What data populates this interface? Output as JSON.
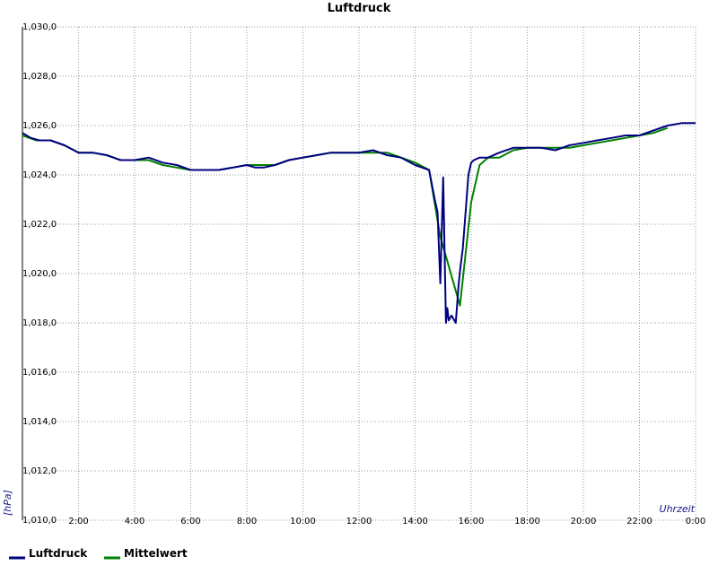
{
  "chart_data": {
    "type": "line",
    "title": "Luftdruck",
    "ylabel": "[hPa]",
    "xlabel": "Uhrzeit",
    "ylim": [
      1010,
      1030
    ],
    "xlim": [
      0,
      24
    ],
    "y_ticks": [
      1010,
      1012,
      1014,
      1016,
      1018,
      1020,
      1022,
      1024,
      1026,
      1028,
      1030
    ],
    "y_tick_labels": [
      "1,010,0",
      "1,012,0",
      "1,014,0",
      "1,016,0",
      "1,018,0",
      "1,020,0",
      "1,022,0",
      "1,024,0",
      "1,026,0",
      "1,028,0",
      "1,030,0"
    ],
    "x_ticks": [
      2,
      4,
      6,
      8,
      10,
      12,
      14,
      16,
      18,
      20,
      22,
      24
    ],
    "x_tick_labels": [
      "2:00",
      "4:00",
      "6:00",
      "8:00",
      "10:00",
      "12:00",
      "14:00",
      "16:00",
      "18:00",
      "20:00",
      "22:00",
      "0:00"
    ],
    "grid": true,
    "legend_position": "bottom-left",
    "series": [
      {
        "name": "Luftdruck",
        "color": "#000080",
        "x": [
          0,
          0.3,
          0.6,
          1.0,
          1.5,
          2.0,
          2.5,
          3.0,
          3.5,
          4.0,
          4.5,
          5.0,
          5.5,
          6.0,
          6.5,
          7.0,
          7.5,
          8.0,
          8.3,
          8.6,
          9.0,
          9.5,
          10.0,
          10.5,
          11.0,
          11.5,
          12.0,
          12.5,
          13.0,
          13.5,
          14.0,
          14.5,
          14.7,
          14.8,
          14.9,
          15.0,
          15.05,
          15.1,
          15.15,
          15.2,
          15.3,
          15.45,
          15.55,
          15.6,
          15.7,
          15.8,
          15.9,
          16.0,
          16.1,
          16.3,
          16.6,
          17.0,
          17.5,
          18.0,
          18.5,
          19.0,
          19.5,
          20.0,
          20.5,
          21.0,
          21.5,
          22.0,
          22.5,
          23.0,
          23.5,
          24.0
        ],
        "y": [
          1025.7,
          1025.5,
          1025.4,
          1025.4,
          1025.2,
          1024.9,
          1024.9,
          1024.8,
          1024.6,
          1024.6,
          1024.7,
          1024.5,
          1024.4,
          1024.2,
          1024.2,
          1024.2,
          1024.3,
          1024.4,
          1024.3,
          1024.3,
          1024.4,
          1024.6,
          1024.7,
          1024.8,
          1024.9,
          1024.9,
          1024.9,
          1025.0,
          1024.8,
          1024.7,
          1024.4,
          1024.2,
          1023.0,
          1022.5,
          1019.6,
          1023.9,
          1021.0,
          1018.0,
          1018.6,
          1018.1,
          1018.3,
          1018.0,
          1019.5,
          1020.1,
          1021.0,
          1022.5,
          1024.0,
          1024.5,
          1024.6,
          1024.7,
          1024.7,
          1024.9,
          1025.1,
          1025.1,
          1025.1,
          1025.0,
          1025.2,
          1025.3,
          1025.4,
          1025.5,
          1025.6,
          1025.6,
          1025.8,
          1026.0,
          1026.1,
          1026.1
        ]
      },
      {
        "name": "Mittelwert",
        "color": "#008000",
        "x": [
          0,
          0.5,
          1.0,
          1.5,
          2.0,
          2.5,
          3.0,
          3.5,
          4.0,
          4.5,
          5.0,
          5.5,
          6.0,
          6.5,
          7.0,
          7.5,
          8.0,
          8.5,
          9.0,
          9.5,
          10.0,
          10.5,
          11.0,
          11.5,
          12.0,
          12.5,
          13.0,
          13.5,
          14.0,
          14.5,
          14.9,
          15.6,
          16.0,
          16.3,
          16.6,
          17.0,
          17.5,
          18.0,
          18.5,
          19.0,
          19.5,
          20.0,
          20.5,
          21.0,
          21.5,
          22.0,
          22.5,
          23.0
        ],
        "y": [
          1025.6,
          1025.4,
          1025.4,
          1025.2,
          1024.9,
          1024.9,
          1024.8,
          1024.6,
          1024.6,
          1024.6,
          1024.4,
          1024.3,
          1024.2,
          1024.2,
          1024.2,
          1024.3,
          1024.4,
          1024.4,
          1024.4,
          1024.6,
          1024.7,
          1024.8,
          1024.9,
          1024.9,
          1024.9,
          1024.9,
          1024.9,
          1024.7,
          1024.5,
          1024.2,
          1021.5,
          1018.7,
          1022.9,
          1024.4,
          1024.7,
          1024.7,
          1025.0,
          1025.1,
          1025.1,
          1025.1,
          1025.1,
          1025.2,
          1025.3,
          1025.4,
          1025.5,
          1025.6,
          1025.7,
          1025.9
        ]
      }
    ]
  }
}
